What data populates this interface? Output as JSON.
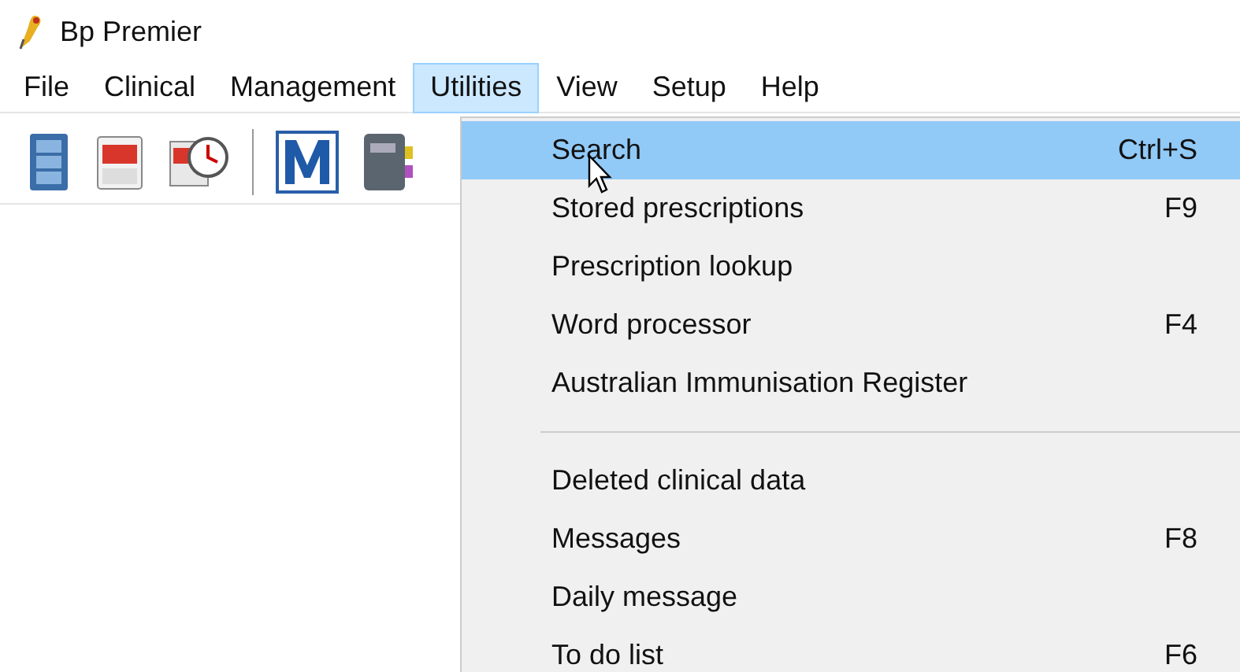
{
  "window": {
    "title": "Bp Premier"
  },
  "menu_bar": [
    {
      "label": "File",
      "selected": false
    },
    {
      "label": "Clinical",
      "selected": false
    },
    {
      "label": "Management",
      "selected": false
    },
    {
      "label": "Utilities",
      "selected": true
    },
    {
      "label": "View",
      "selected": false
    },
    {
      "label": "Setup",
      "selected": false
    },
    {
      "label": "Help",
      "selected": false
    }
  ],
  "dropdown": [
    {
      "kind": "item",
      "label": "Search",
      "shortcut": "Ctrl+S",
      "selected": true
    },
    {
      "kind": "item",
      "label": "Stored prescriptions",
      "shortcut": "F9",
      "selected": false
    },
    {
      "kind": "item",
      "label": "Prescription lookup",
      "selected": false
    },
    {
      "kind": "item",
      "label": "Word processor",
      "shortcut": "F4",
      "selected": false
    },
    {
      "kind": "item",
      "label": "Australian Immunisation Register",
      "selected": false
    },
    {
      "kind": "separator"
    },
    {
      "kind": "item",
      "label": "Deleted clinical data",
      "selected": false
    },
    {
      "kind": "item",
      "label": "Messages",
      "shortcut": "F8",
      "selected": false
    },
    {
      "kind": "item",
      "label": "Daily message",
      "selected": false
    },
    {
      "kind": "item",
      "label": "To do list",
      "shortcut": "F6",
      "selected": false
    }
  ]
}
